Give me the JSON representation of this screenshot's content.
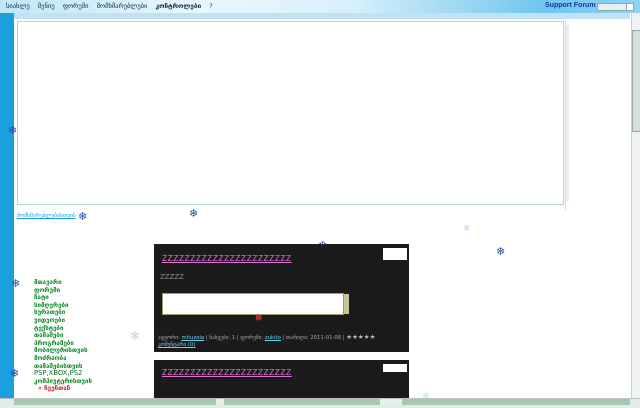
{
  "topnav": {
    "items": [
      "სიახლე",
      "მენიუ",
      "ფორუმი",
      "მომხმარებლები",
      "კონტროლები",
      "?"
    ],
    "support": "Support Forum"
  },
  "sublink": "მომხმარებლებისთვის",
  "sidemenu": [
    "მთავარი",
    "ფორუმი",
    "ჩატი",
    "სიმღერები",
    "სურათები",
    "ვიდეოები",
    "ტექსტები",
    "თამაშები",
    "პროგრამები",
    "მობილურისთვის",
    "მოძრაობა",
    "თამაშებისთვის"
  ],
  "sidemenu_plain": "PSP,XBOX,PS2",
  "sidemenu_extra": "კომპიუტერისთვის",
  "sidemenu_current": "» ჩვენთან",
  "post1": {
    "title": "ZZZZZZZZZZZZZZZZZZZZZZZ",
    "text": "ZZZZZ",
    "smile": "☻",
    "meta": {
      "author_label": "ავტორი:",
      "author": "mhuzola",
      "views_label": "ნახვები:",
      "views": "1",
      "cat_label": "ფორუმი:",
      "cat": "zukito",
      "date_label": "თარიღი:",
      "date": "2011-01-08",
      "comments": "კომენტარი (0)",
      "stars": "★★★★★"
    }
  },
  "post2": {
    "title": "ZZZZZZZZZZZZZZZZZZZZZZZ"
  }
}
